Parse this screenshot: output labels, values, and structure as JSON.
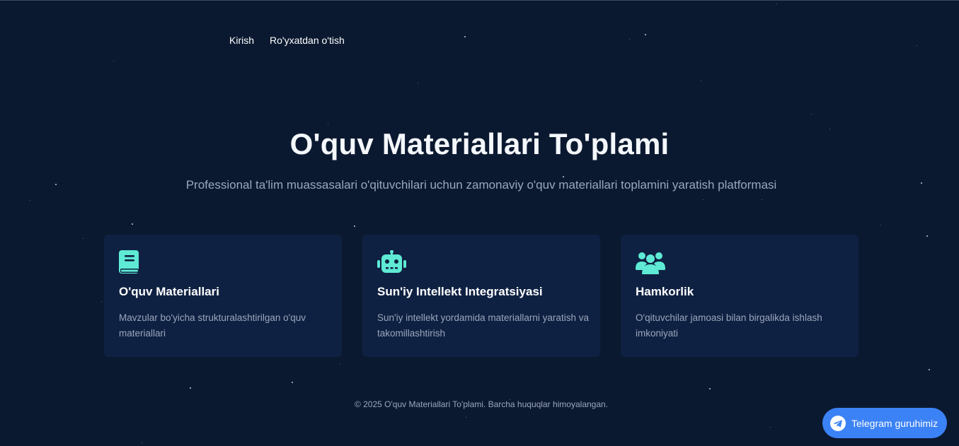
{
  "nav": {
    "login_label": "Kirish",
    "register_label": "Ro'yxatdan o'tish"
  },
  "hero": {
    "title": "O'quv Materiallari To'plami",
    "subtitle": "Professional ta'lim muassasalari o'qituvchilari uchun zamonaviy o'quv materiallari toplamini yaratish platformasi"
  },
  "features": [
    {
      "icon": "book-icon",
      "title": "O'quv Materiallari",
      "description": "Mavzular bo'yicha strukturalashtirilgan o'quv materiallari"
    },
    {
      "icon": "robot-icon",
      "title": "Sun'iy Intellekt Integratsiyasi",
      "description": "Sun'iy intellekt yordamida materiallarni yaratish va takomillashtirish"
    },
    {
      "icon": "users-icon",
      "title": "Hamkorlik",
      "description": "O'qituvchilar jamoasi bilan birgalikda ishlash imkoniyati"
    }
  ],
  "footer": {
    "copyright": "© 2025 O'quv Materiallari To'plami. Barcha huquqlar himoyalangan."
  },
  "telegram": {
    "label": "Telegram guruhimiz",
    "icon": "telegram-icon"
  },
  "colors": {
    "background": "#0b1930",
    "card_background": "#0f2142",
    "accent_icon": "#5eead4",
    "telegram_button": "#3b82f6",
    "muted_text": "#9aa6bb"
  }
}
